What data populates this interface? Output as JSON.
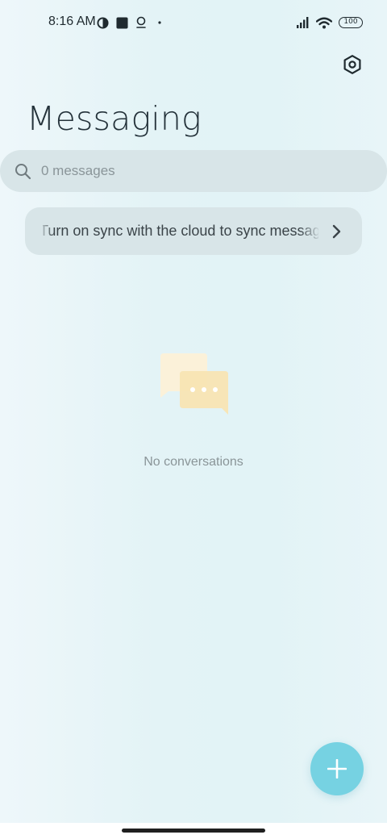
{
  "status_bar": {
    "time": "8:16 AM",
    "battery": "100",
    "left_icons": [
      "half-moon-icon",
      "square-icon",
      "location-pin-icon",
      "dot-icon"
    ],
    "right_icons": [
      "signal-icon",
      "wifi-icon",
      "battery-icon"
    ]
  },
  "header": {
    "title": "Messaging",
    "settings_icon": "hexagon-settings-icon"
  },
  "search": {
    "placeholder": "0 messages",
    "icon": "search-icon"
  },
  "sync_banner": {
    "text": "Turn on sync with the cloud to sync messages",
    "icon": "chevron-right-icon"
  },
  "empty_state": {
    "icon": "chat-bubbles-icon",
    "text": "No conversations"
  },
  "fab": {
    "icon": "plus-icon"
  },
  "colors": {
    "accent": "#76d2e2",
    "background": "#e3f3f6",
    "card": "#d8e5e8",
    "title": "#24323a"
  }
}
